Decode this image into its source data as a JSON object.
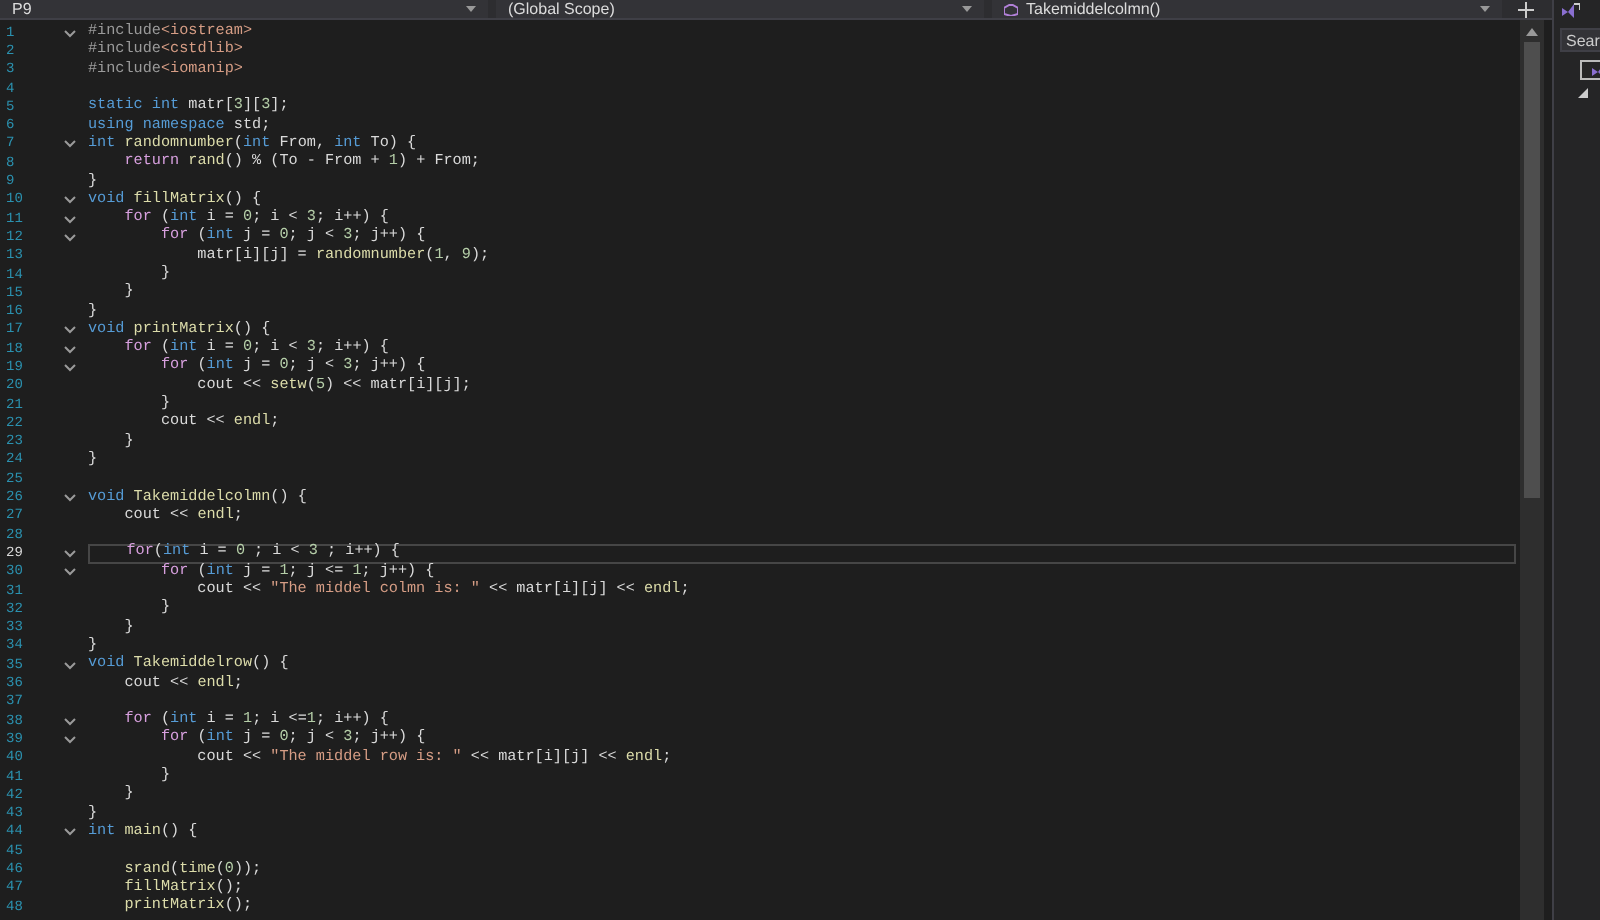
{
  "toolbar": {
    "file_dropdown": "P9",
    "scope_dropdown": "(Global Scope)",
    "member_dropdown": "Takemiddelcolmn()"
  },
  "editor": {
    "lines": [
      {
        "number": "1",
        "fold": true,
        "current": false,
        "tokens": [
          {
            "kind": "directive",
            "text": "#include"
          },
          {
            "kind": "string",
            "text": "<iostream>"
          }
        ]
      },
      {
        "number": "2",
        "fold": false,
        "current": false,
        "tokens": [
          {
            "kind": "directive",
            "text": "#include"
          },
          {
            "kind": "string",
            "text": "<cstdlib>"
          }
        ]
      },
      {
        "number": "3",
        "fold": false,
        "current": false,
        "tokens": [
          {
            "kind": "directive",
            "text": "#include"
          },
          {
            "kind": "string",
            "text": "<iomanip>"
          }
        ]
      },
      {
        "number": "4",
        "fold": false,
        "current": false
      },
      {
        "number": "5",
        "fold": false,
        "current": false,
        "tokens": [
          {
            "kind": "keyword",
            "text": "static"
          },
          {
            "kind": "keyword",
            "text": " int"
          },
          {
            "kind": "plain",
            "text": " matr["
          },
          {
            "kind": "number",
            "text": "3"
          },
          {
            "kind": "plain",
            "text": "]["
          },
          {
            "kind": "number",
            "text": "3"
          },
          {
            "kind": "plain",
            "text": "];"
          }
        ]
      },
      {
        "number": "6",
        "fold": false,
        "current": false,
        "tokens": [
          {
            "kind": "keyword",
            "text": "using"
          },
          {
            "kind": "keyword",
            "text": " namespace"
          },
          {
            "kind": "plain",
            "text": " std;"
          }
        ]
      },
      {
        "number": "7",
        "fold": true,
        "current": false,
        "tokens": [
          {
            "kind": "keyword",
            "text": "int"
          },
          {
            "kind": "function",
            "text": " randomnumber"
          },
          {
            "kind": "plain",
            "text": "("
          },
          {
            "kind": "keyword",
            "text": "int"
          },
          {
            "kind": "plain",
            "text": " From, "
          },
          {
            "kind": "keyword",
            "text": "int"
          },
          {
            "kind": "plain",
            "text": " To) {"
          }
        ]
      },
      {
        "number": "8",
        "fold": false,
        "current": false,
        "tokens": [
          {
            "kind": "control",
            "text": "    return"
          },
          {
            "kind": "function",
            "text": " rand"
          },
          {
            "kind": "plain",
            "text": "() % (To - From + "
          },
          {
            "kind": "number",
            "text": "1"
          },
          {
            "kind": "plain",
            "text": ") + From;"
          }
        ]
      },
      {
        "number": "9",
        "fold": false,
        "current": false,
        "tokens": [
          {
            "kind": "plain",
            "text": "}"
          }
        ]
      },
      {
        "number": "10",
        "fold": true,
        "current": false,
        "tokens": [
          {
            "kind": "keyword",
            "text": "void"
          },
          {
            "kind": "function",
            "text": " fillMatrix"
          },
          {
            "kind": "plain",
            "text": "() {"
          }
        ]
      },
      {
        "number": "11",
        "fold": true,
        "current": false,
        "tokens": [
          {
            "kind": "control",
            "text": "    for"
          },
          {
            "kind": "plain",
            "text": " ("
          },
          {
            "kind": "keyword",
            "text": "int"
          },
          {
            "kind": "plain",
            "text": " i = "
          },
          {
            "kind": "number",
            "text": "0"
          },
          {
            "kind": "plain",
            "text": "; i < "
          },
          {
            "kind": "number",
            "text": "3"
          },
          {
            "kind": "plain",
            "text": "; i++) {"
          }
        ]
      },
      {
        "number": "12",
        "fold": true,
        "current": false,
        "tokens": [
          {
            "kind": "control",
            "text": "        for"
          },
          {
            "kind": "plain",
            "text": " ("
          },
          {
            "kind": "keyword",
            "text": "int"
          },
          {
            "kind": "plain",
            "text": " j = "
          },
          {
            "kind": "number",
            "text": "0"
          },
          {
            "kind": "plain",
            "text": "; j < "
          },
          {
            "kind": "number",
            "text": "3"
          },
          {
            "kind": "plain",
            "text": "; j++) {"
          }
        ]
      },
      {
        "number": "13",
        "fold": false,
        "current": false,
        "tokens": [
          {
            "kind": "plain",
            "text": "            matr[i][j] = "
          },
          {
            "kind": "function",
            "text": "randomnumber"
          },
          {
            "kind": "plain",
            "text": "("
          },
          {
            "kind": "number",
            "text": "1"
          },
          {
            "kind": "plain",
            "text": ", "
          },
          {
            "kind": "number",
            "text": "9"
          },
          {
            "kind": "plain",
            "text": ");"
          }
        ]
      },
      {
        "number": "14",
        "fold": false,
        "current": false,
        "tokens": [
          {
            "kind": "plain",
            "text": "        }"
          }
        ]
      },
      {
        "number": "15",
        "fold": false,
        "current": false,
        "tokens": [
          {
            "kind": "plain",
            "text": "    }"
          }
        ]
      },
      {
        "number": "16",
        "fold": false,
        "current": false,
        "tokens": [
          {
            "kind": "plain",
            "text": "}"
          }
        ]
      },
      {
        "number": "17",
        "fold": true,
        "current": false,
        "tokens": [
          {
            "kind": "keyword",
            "text": "void"
          },
          {
            "kind": "function",
            "text": " printMatrix"
          },
          {
            "kind": "plain",
            "text": "() {"
          }
        ]
      },
      {
        "number": "18",
        "fold": true,
        "current": false,
        "tokens": [
          {
            "kind": "control",
            "text": "    for"
          },
          {
            "kind": "plain",
            "text": " ("
          },
          {
            "kind": "keyword",
            "text": "int"
          },
          {
            "kind": "plain",
            "text": " i = "
          },
          {
            "kind": "number",
            "text": "0"
          },
          {
            "kind": "plain",
            "text": "; i < "
          },
          {
            "kind": "number",
            "text": "3"
          },
          {
            "kind": "plain",
            "text": "; i++) {"
          }
        ]
      },
      {
        "number": "19",
        "fold": true,
        "current": false,
        "tokens": [
          {
            "kind": "control",
            "text": "        for"
          },
          {
            "kind": "plain",
            "text": " ("
          },
          {
            "kind": "keyword",
            "text": "int"
          },
          {
            "kind": "plain",
            "text": " j = "
          },
          {
            "kind": "number",
            "text": "0"
          },
          {
            "kind": "plain",
            "text": "; j < "
          },
          {
            "kind": "number",
            "text": "3"
          },
          {
            "kind": "plain",
            "text": "; j++) {"
          }
        ]
      },
      {
        "number": "20",
        "fold": false,
        "current": false,
        "tokens": [
          {
            "kind": "plain",
            "text": "            cout << "
          },
          {
            "kind": "function",
            "text": "setw"
          },
          {
            "kind": "plain",
            "text": "("
          },
          {
            "kind": "number",
            "text": "5"
          },
          {
            "kind": "plain",
            "text": ") << matr[i][j];"
          }
        ]
      },
      {
        "number": "21",
        "fold": false,
        "current": false,
        "tokens": [
          {
            "kind": "plain",
            "text": "        }"
          }
        ]
      },
      {
        "number": "22",
        "fold": false,
        "current": false,
        "tokens": [
          {
            "kind": "plain",
            "text": "        cout << "
          },
          {
            "kind": "function",
            "text": "endl"
          },
          {
            "kind": "plain",
            "text": ";"
          }
        ]
      },
      {
        "number": "23",
        "fold": false,
        "current": false,
        "tokens": [
          {
            "kind": "plain",
            "text": "    }"
          }
        ]
      },
      {
        "number": "24",
        "fold": false,
        "current": false,
        "tokens": [
          {
            "kind": "plain",
            "text": "}"
          }
        ]
      },
      {
        "number": "25",
        "fold": false,
        "current": false
      },
      {
        "number": "26",
        "fold": true,
        "current": false,
        "tokens": [
          {
            "kind": "keyword",
            "text": "void"
          },
          {
            "kind": "function",
            "text": " Takemiddelcolmn"
          },
          {
            "kind": "plain",
            "text": "() {"
          }
        ]
      },
      {
        "number": "27",
        "fold": false,
        "current": false,
        "tokens": [
          {
            "kind": "plain",
            "text": "    cout << "
          },
          {
            "kind": "function",
            "text": "endl"
          },
          {
            "kind": "plain",
            "text": ";"
          }
        ]
      },
      {
        "number": "28",
        "fold": false,
        "current": false
      },
      {
        "number": "29",
        "fold": true,
        "current": true,
        "tokens": [
          {
            "kind": "control",
            "text": "    for"
          },
          {
            "kind": "plain",
            "text": "("
          },
          {
            "kind": "keyword",
            "text": "int"
          },
          {
            "kind": "plain",
            "text": " i = "
          },
          {
            "kind": "number",
            "text": "0"
          },
          {
            "kind": "plain",
            "text": " ; i < "
          },
          {
            "kind": "number",
            "text": "3"
          },
          {
            "kind": "plain",
            "text": " ; i++) {"
          }
        ]
      },
      {
        "number": "30",
        "fold": true,
        "current": false,
        "tokens": [
          {
            "kind": "control",
            "text": "        for"
          },
          {
            "kind": "plain",
            "text": " ("
          },
          {
            "kind": "keyword",
            "text": "int"
          },
          {
            "kind": "plain",
            "text": " j = "
          },
          {
            "kind": "number",
            "text": "1"
          },
          {
            "kind": "plain",
            "text": "; j <= "
          },
          {
            "kind": "number",
            "text": "1"
          },
          {
            "kind": "plain",
            "text": "; j++) {"
          }
        ]
      },
      {
        "number": "31",
        "fold": false,
        "current": false,
        "tokens": [
          {
            "kind": "plain",
            "text": "            cout << "
          },
          {
            "kind": "string",
            "text": "\"The middel colmn is: \""
          },
          {
            "kind": "plain",
            "text": " << matr[i][j] << "
          },
          {
            "kind": "function",
            "text": "endl"
          },
          {
            "kind": "plain",
            "text": ";"
          }
        ]
      },
      {
        "number": "32",
        "fold": false,
        "current": false,
        "tokens": [
          {
            "kind": "plain",
            "text": "        }"
          }
        ]
      },
      {
        "number": "33",
        "fold": false,
        "current": false,
        "tokens": [
          {
            "kind": "plain",
            "text": "    }"
          }
        ]
      },
      {
        "number": "34",
        "fold": false,
        "current": false,
        "tokens": [
          {
            "kind": "plain",
            "text": "}"
          }
        ]
      },
      {
        "number": "35",
        "fold": true,
        "current": false,
        "tokens": [
          {
            "kind": "keyword",
            "text": "void"
          },
          {
            "kind": "function",
            "text": " Takemiddelrow"
          },
          {
            "kind": "plain",
            "text": "() {"
          }
        ]
      },
      {
        "number": "36",
        "fold": false,
        "current": false,
        "tokens": [
          {
            "kind": "plain",
            "text": "    cout << "
          },
          {
            "kind": "function",
            "text": "endl"
          },
          {
            "kind": "plain",
            "text": ";"
          }
        ]
      },
      {
        "number": "37",
        "fold": false,
        "current": false
      },
      {
        "number": "38",
        "fold": true,
        "current": false,
        "tokens": [
          {
            "kind": "control",
            "text": "    for"
          },
          {
            "kind": "plain",
            "text": " ("
          },
          {
            "kind": "keyword",
            "text": "int"
          },
          {
            "kind": "plain",
            "text": " i = "
          },
          {
            "kind": "number",
            "text": "1"
          },
          {
            "kind": "plain",
            "text": "; i <="
          },
          {
            "kind": "number",
            "text": "1"
          },
          {
            "kind": "plain",
            "text": "; i++) {"
          }
        ]
      },
      {
        "number": "39",
        "fold": true,
        "current": false,
        "tokens": [
          {
            "kind": "control",
            "text": "        for"
          },
          {
            "kind": "plain",
            "text": " ("
          },
          {
            "kind": "keyword",
            "text": "int"
          },
          {
            "kind": "plain",
            "text": " j = "
          },
          {
            "kind": "number",
            "text": "0"
          },
          {
            "kind": "plain",
            "text": "; j < "
          },
          {
            "kind": "number",
            "text": "3"
          },
          {
            "kind": "plain",
            "text": "; j++) {"
          }
        ]
      },
      {
        "number": "40",
        "fold": false,
        "current": false,
        "tokens": [
          {
            "kind": "plain",
            "text": "            cout << "
          },
          {
            "kind": "string",
            "text": "\"The middel row is: \""
          },
          {
            "kind": "plain",
            "text": " << matr[i][j] << "
          },
          {
            "kind": "function",
            "text": "endl"
          },
          {
            "kind": "plain",
            "text": ";"
          }
        ]
      },
      {
        "number": "41",
        "fold": false,
        "current": false,
        "tokens": [
          {
            "kind": "plain",
            "text": "        }"
          }
        ]
      },
      {
        "number": "42",
        "fold": false,
        "current": false,
        "tokens": [
          {
            "kind": "plain",
            "text": "    }"
          }
        ]
      },
      {
        "number": "43",
        "fold": false,
        "current": false,
        "tokens": [
          {
            "kind": "plain",
            "text": "}"
          }
        ]
      },
      {
        "number": "44",
        "fold": true,
        "current": false,
        "tokens": [
          {
            "kind": "keyword",
            "text": "int"
          },
          {
            "kind": "function",
            "text": " main"
          },
          {
            "kind": "plain",
            "text": "() {"
          }
        ]
      },
      {
        "number": "45",
        "fold": false,
        "current": false
      },
      {
        "number": "46",
        "fold": false,
        "current": false,
        "tokens": [
          {
            "kind": "function",
            "text": "    srand"
          },
          {
            "kind": "plain",
            "text": "("
          },
          {
            "kind": "function",
            "text": "time"
          },
          {
            "kind": "plain",
            "text": "("
          },
          {
            "kind": "number",
            "text": "0"
          },
          {
            "kind": "plain",
            "text": "));"
          }
        ]
      },
      {
        "number": "47",
        "fold": false,
        "current": false,
        "tokens": [
          {
            "kind": "function",
            "text": "    fillMatrix"
          },
          {
            "kind": "plain",
            "text": "();"
          }
        ]
      },
      {
        "number": "48",
        "fold": false,
        "current": false,
        "tokens": [
          {
            "kind": "function",
            "text": "    printMatrix"
          },
          {
            "kind": "plain",
            "text": "();"
          }
        ]
      }
    ]
  },
  "side_panel": {
    "search": {
      "placeholder": "Sear"
    }
  }
}
